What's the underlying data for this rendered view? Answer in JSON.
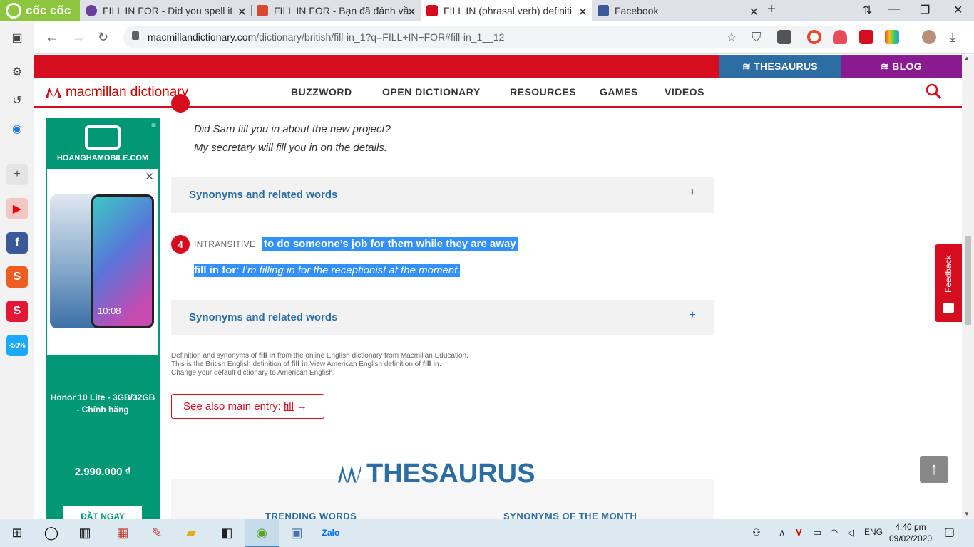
{
  "browser": {
    "brand": "cốc cốc",
    "tabs": [
      {
        "title": "FILL IN FOR - Did you spell it",
        "color": "#6a3fa0"
      },
      {
        "title": "FILL IN FOR - Bạn đã đánh vầ",
        "color": "#d9492d"
      },
      {
        "title": "FILL IN (phrasal verb) definiti",
        "color": "#d60d1f",
        "active": true
      },
      {
        "title": "Facebook",
        "color": "#3b5998"
      }
    ],
    "url_domain": "macmillandictionary.com",
    "url_path": "/dictionary/british/fill-in_1?q=FILL+IN+FOR#fill-in_1__12"
  },
  "site": {
    "topnav": {
      "thesaurus": "THESAURUS",
      "blog": "BLOG"
    },
    "logo": "macmillan dictionary",
    "nav": [
      "BUZZWORD",
      "OPEN DICTIONARY",
      "RESOURCES",
      "GAMES",
      "VIDEOS"
    ]
  },
  "ad": {
    "brand": "HOANGHAMOBILE.COM",
    "phone_time": "10:08",
    "title": "Honor 10 Lite - 3GB/32GB - Chính hãng",
    "price": "2.990.000 ₫",
    "cta": "ĐẶT NGAY"
  },
  "entry": {
    "examples_3": [
      "Did Sam fill you in about the new project?",
      "My secretary will fill you in on the details."
    ],
    "synonyms_label": "Synonyms and related words",
    "sense_4": {
      "number": "4",
      "grammar": "INTRANSITIVE",
      "definition": "to do someone’s job for them while they are away",
      "phrase": "fill in for",
      "example": ": I’m filling in for the receptionist at the moment."
    },
    "footnote": {
      "l1a": "Definition and synonyms of ",
      "l1b": "fill in",
      "l1c": " from the online English dictionary from Macmillan Education.",
      "l2a": "This is the British English definition of ",
      "l2b": "fill in",
      "l2c": ".View American English definition of ",
      "l2d": "fill in",
      "l2e": ".",
      "l3": "Change your default dictionary to American English."
    },
    "see_also_prefix": "See also main entry: ",
    "see_also_link": "fill",
    "see_also_arrow": "→"
  },
  "thesaurus": {
    "title": "THESAURUS",
    "trending": "TRENDING WORDS",
    "synonyms_month": "SYNONYMS OF THE MONTH"
  },
  "feedback": "Feedback",
  "taskbar": {
    "lang": "ENG",
    "time": "4:40 pm",
    "date": "09/02/2020"
  }
}
